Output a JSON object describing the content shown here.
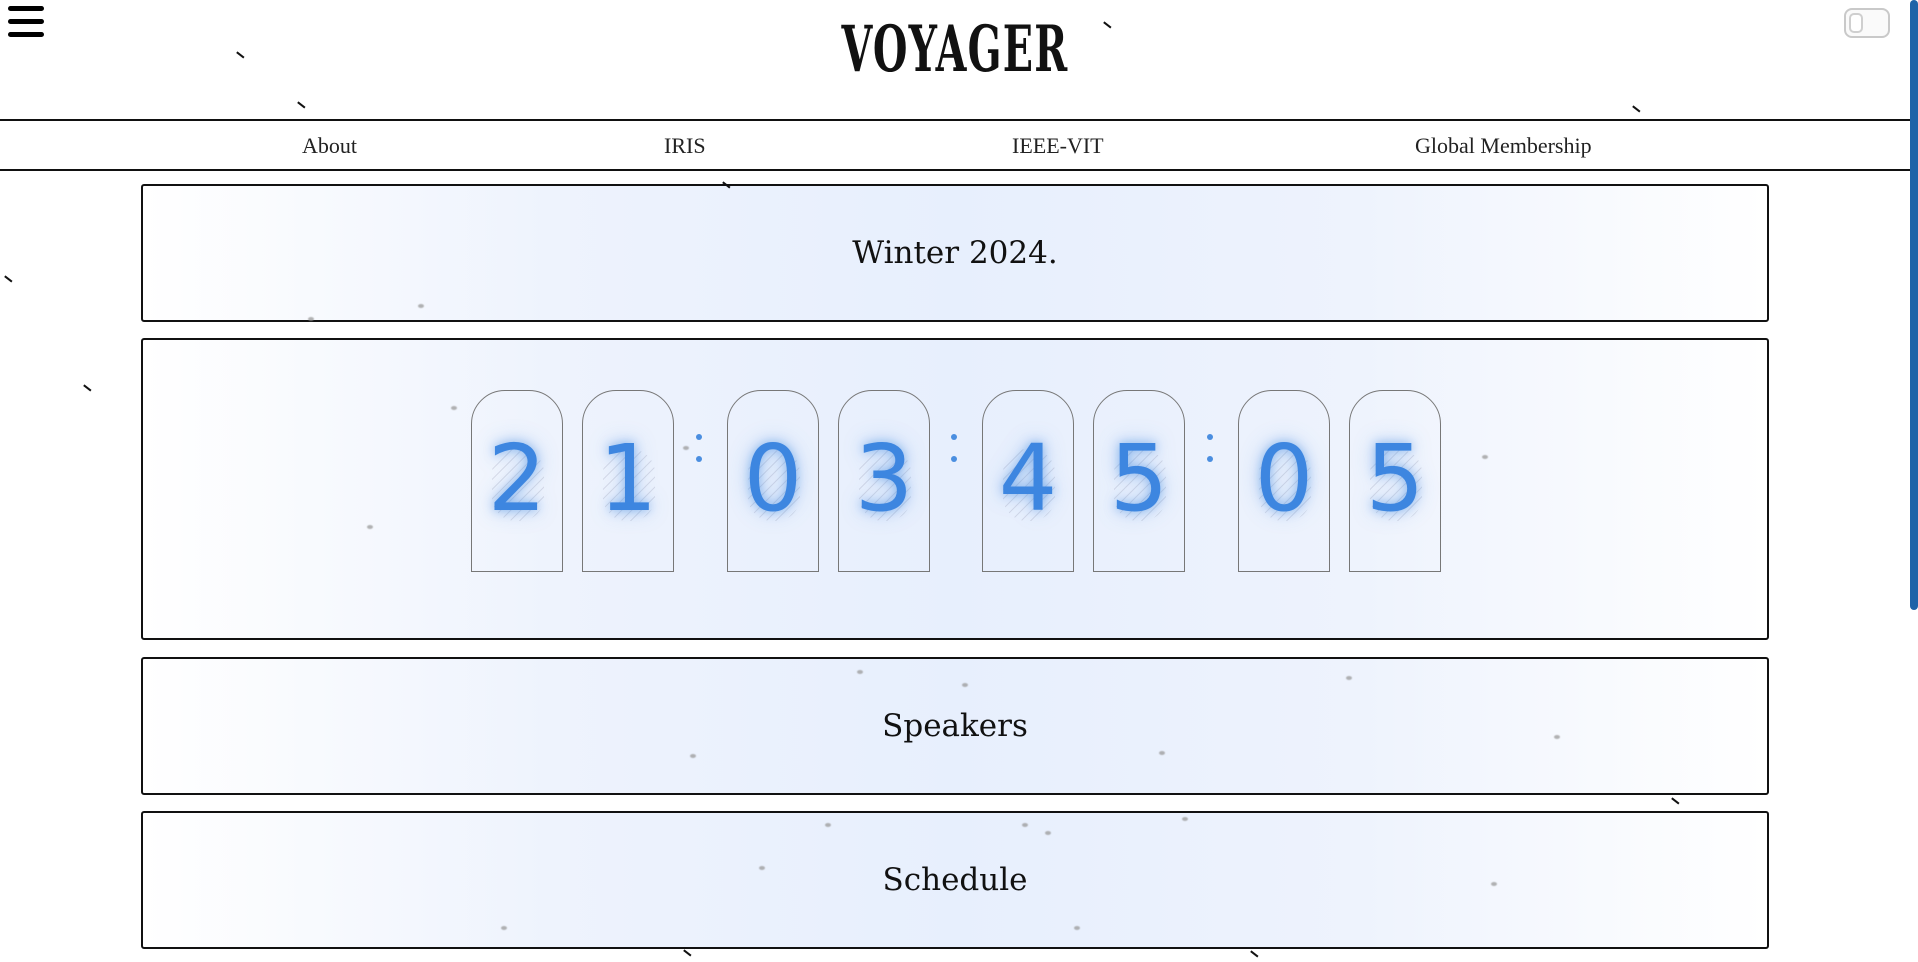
{
  "header": {
    "logo_text": "VOYAGER",
    "menu_icon": "hamburger-menu-icon",
    "theme_toggle_icon": "toggle-switch-icon"
  },
  "nav": {
    "items": [
      {
        "label": "About"
      },
      {
        "label": "IRIS"
      },
      {
        "label": "IEEE-VIT"
      },
      {
        "label": "Global Membership"
      }
    ]
  },
  "panels": {
    "season": "Winter 2024.",
    "speakers": "Speakers",
    "schedule": "Schedule"
  },
  "countdown": {
    "digits": [
      "2",
      "1",
      "0",
      "3",
      "4",
      "5",
      "0",
      "5"
    ],
    "separator": ":",
    "accent_color": "#3d86e0"
  },
  "colors": {
    "accent": "#3d86e0",
    "scrollbar": "#1f63a8",
    "border": "#111111"
  }
}
